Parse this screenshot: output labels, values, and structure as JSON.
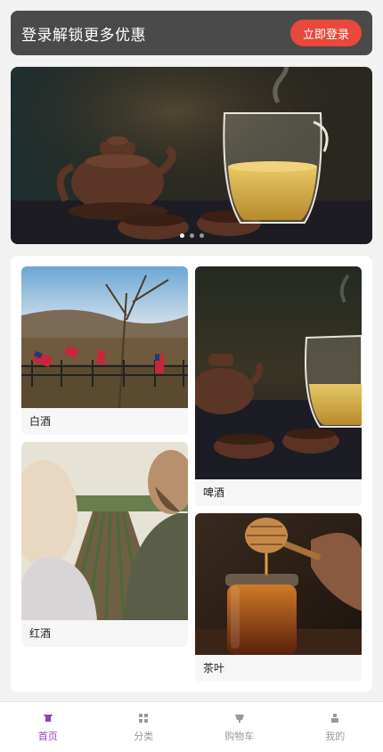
{
  "login_banner": {
    "text": "登录解锁更多优惠",
    "button_label": "立即登录"
  },
  "carousel": {
    "slide_count": 3,
    "active_index": 0
  },
  "categories": [
    {
      "label": "白酒"
    },
    {
      "label": "啤酒"
    },
    {
      "label": "红酒"
    },
    {
      "label": "茶叶"
    }
  ],
  "tabbar": {
    "items": [
      {
        "label": "首页",
        "icon": "home-icon",
        "active": true
      },
      {
        "label": "分类",
        "icon": "grid-icon",
        "active": false
      },
      {
        "label": "购物车",
        "icon": "cart-icon",
        "active": false
      },
      {
        "label": "我的",
        "icon": "user-icon",
        "active": false
      }
    ]
  },
  "colors": {
    "accent": "#8e3ec8",
    "login_button": "#e8493d",
    "banner_bg": "#4a4a4a"
  }
}
